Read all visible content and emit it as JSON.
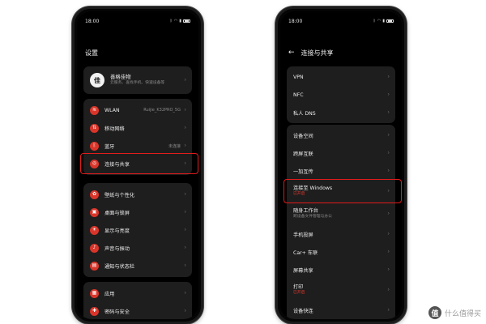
{
  "left_phone": {
    "status": {
      "time": "18:00"
    },
    "title": "设置",
    "account": {
      "icon": "user-avatar",
      "glyph": "佳",
      "name": "善格佳物",
      "sub": "云服务、查找手机、快速设备等"
    },
    "network": [
      {
        "label": "WLAN",
        "value": "Ruijie_K32PRO_5G",
        "icon": "wifi-icon",
        "glyph": "≋"
      },
      {
        "label": "移动网络",
        "value": "",
        "icon": "signal-icon",
        "glyph": "⇅"
      },
      {
        "label": "蓝牙",
        "value": "未连接",
        "icon": "bluetooth-icon",
        "glyph": "ᛒ"
      },
      {
        "label": "连接与共享",
        "value": "",
        "icon": "share-icon",
        "glyph": "◎"
      }
    ],
    "display": [
      {
        "label": "壁纸与个性化",
        "icon": "palette-icon",
        "glyph": "✿"
      },
      {
        "label": "桌面与锁屏",
        "icon": "desktop-icon",
        "glyph": "▣"
      },
      {
        "label": "显示与亮度",
        "icon": "brightness-icon",
        "glyph": "☀"
      },
      {
        "label": "声音与振动",
        "icon": "sound-icon",
        "glyph": "♪"
      },
      {
        "label": "通知与状态栏",
        "icon": "notification-icon",
        "glyph": "▤"
      }
    ],
    "apps": [
      {
        "label": "应用",
        "icon": "apps-icon",
        "glyph": "▦"
      },
      {
        "label": "密码与安全",
        "icon": "lock-icon",
        "glyph": "✚"
      }
    ]
  },
  "right_phone": {
    "status": {
      "time": "18:00"
    },
    "title": "连接与共享",
    "group1": [
      {
        "label": "VPN"
      },
      {
        "label": "NFC"
      },
      {
        "label": "私人 DNS"
      }
    ],
    "group2": [
      {
        "label": "设备空间",
        "sub": ""
      },
      {
        "label": "跨屏互联",
        "sub": ""
      },
      {
        "label": "一加互传",
        "sub": ""
      },
      {
        "label": "连接至 Windows",
        "sub": "已开启",
        "sub_color": "red"
      },
      {
        "label": "随身工作台",
        "sub": "跨设备文件管理与办公"
      },
      {
        "label": "手机投屏",
        "sub": ""
      },
      {
        "label": "Car+ 车联",
        "sub": ""
      },
      {
        "label": "屏幕共享",
        "sub": ""
      },
      {
        "label": "打印",
        "sub": "已开启",
        "sub_color": "red"
      },
      {
        "label": "设备快连",
        "sub": ""
      }
    ]
  },
  "watermark": {
    "glyph": "值",
    "text": "什么值得买"
  },
  "colors": {
    "accent": "#d9352a",
    "highlight": "#e21b1b",
    "background": "#000000",
    "card": "#1e1e1e"
  }
}
